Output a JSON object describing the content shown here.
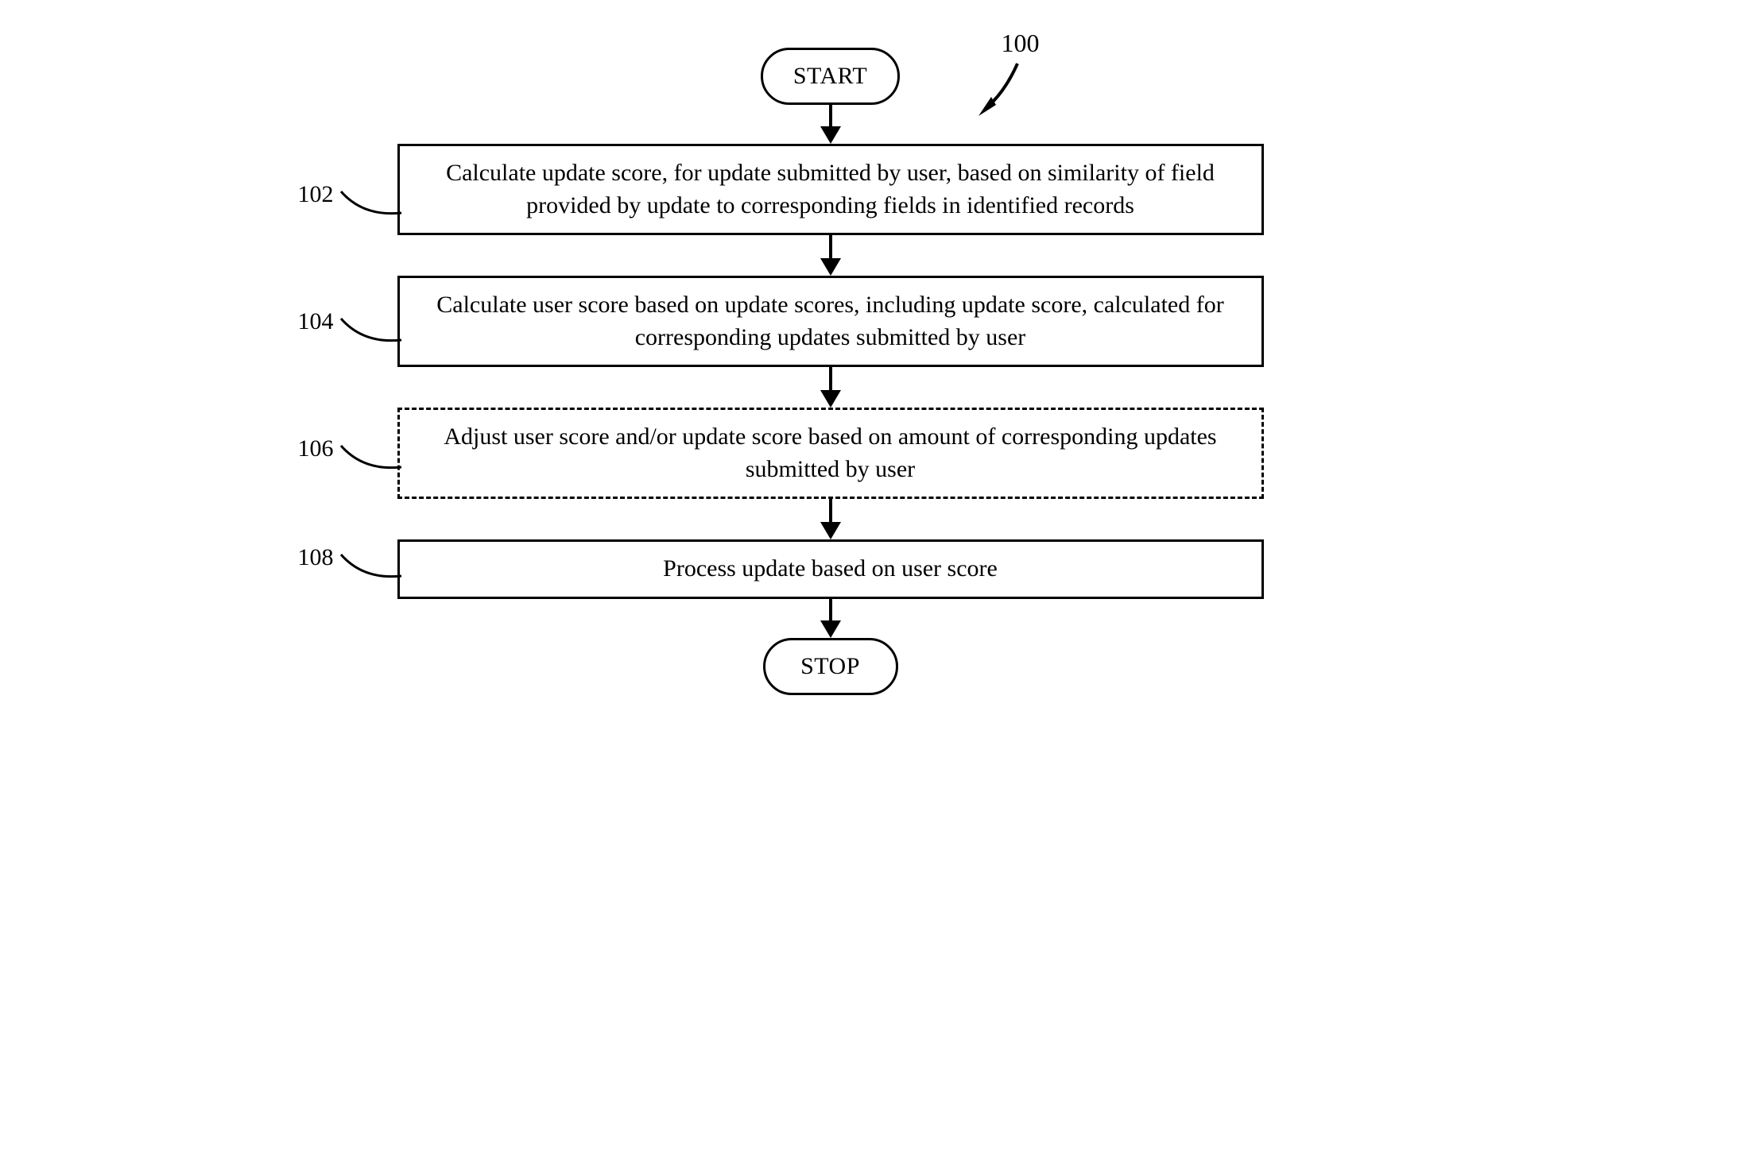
{
  "flowchart": {
    "ref": "100",
    "start": "START",
    "stop": "STOP",
    "steps": [
      {
        "ref": "102",
        "text": "Calculate update score, for update submitted by user, based on similarity of field provided by update to corresponding fields in identified records",
        "dashed": false
      },
      {
        "ref": "104",
        "text": "Calculate user score based on update scores, including update score, calculated for corresponding updates submitted by user",
        "dashed": false
      },
      {
        "ref": "106",
        "text": "Adjust user score and/or update score based on amount of corresponding updates submitted by user",
        "dashed": true
      },
      {
        "ref": "108",
        "text": "Process update based on user score",
        "dashed": false
      }
    ]
  }
}
